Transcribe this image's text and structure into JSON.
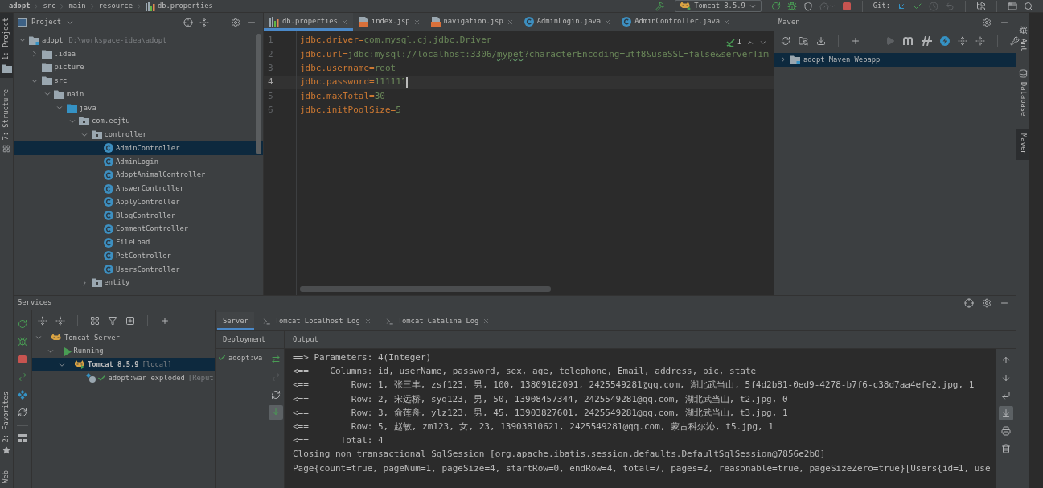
{
  "breadcrumb": [
    "adopt",
    "src",
    "main",
    "resource",
    "db.properties"
  ],
  "toolbar": [
    {
      "kind": "build",
      "disabled": false
    },
    {
      "kind": "run-config",
      "label": "Tomcat 8.5.9"
    },
    {
      "kind": "rerun",
      "disabled": false
    },
    {
      "kind": "debug",
      "disabled": false
    },
    {
      "kind": "coverage",
      "disabled": false
    },
    {
      "kind": "profile",
      "disabled": true
    },
    {
      "kind": "stop",
      "disabled": false
    },
    {
      "kind": "separator"
    },
    {
      "kind": "label",
      "label": "Git:"
    },
    {
      "kind": "update",
      "disabled": false
    },
    {
      "kind": "commit",
      "disabled": false
    },
    {
      "kind": "history",
      "disabled": true
    },
    {
      "kind": "rollback",
      "disabled": true
    },
    {
      "kind": "separator"
    },
    {
      "kind": "project-structure",
      "disabled": false
    },
    {
      "kind": "separator"
    },
    {
      "kind": "tool-window",
      "disabled": false
    },
    {
      "kind": "search",
      "disabled": false
    }
  ],
  "left_stripe": {
    "top": [
      {
        "label": "1: Project",
        "kind": "project",
        "selected": true
      },
      {
        "label": "7: Structure",
        "kind": "structure",
        "selected": false
      }
    ],
    "bottom": [
      {
        "label": "2: Favorites",
        "kind": "favorites",
        "selected": false
      },
      {
        "label": "Web",
        "kind": "web",
        "selected": false
      }
    ]
  },
  "project": {
    "title": "Project",
    "tree": [
      {
        "label": "adopt",
        "path": "D:\\workspace-idea\\adopt",
        "kind": "module",
        "expanded": true,
        "selected": false,
        "children": [
          {
            "label": ".idea",
            "kind": "folder",
            "expanded": false,
            "selected": false
          },
          {
            "label": "picture",
            "kind": "folder",
            "selected": false
          },
          {
            "label": "src",
            "kind": "folder",
            "expanded": true,
            "selected": false,
            "children": [
              {
                "label": "main",
                "kind": "folder",
                "expanded": true,
                "selected": false,
                "children": [
                  {
                    "label": "java",
                    "kind": "source-folder",
                    "expanded": true,
                    "selected": false,
                    "children": [
                      {
                        "label": "com.ecjtu",
                        "kind": "package",
                        "expanded": true,
                        "selected": false,
                        "children": [
                          {
                            "label": "controller",
                            "kind": "package",
                            "expanded": true,
                            "selected": false,
                            "children": [
                              {
                                "label": "AdminController",
                                "kind": "class",
                                "selected": true
                              },
                              {
                                "label": "AdminLogin",
                                "kind": "class",
                                "selected": false
                              },
                              {
                                "label": "AdoptAnimalController",
                                "kind": "class",
                                "selected": false
                              },
                              {
                                "label": "AnswerController",
                                "kind": "class",
                                "selected": false
                              },
                              {
                                "label": "ApplyController",
                                "kind": "class",
                                "selected": false
                              },
                              {
                                "label": "BlogController",
                                "kind": "class",
                                "selected": false
                              },
                              {
                                "label": "CommentController",
                                "kind": "class",
                                "selected": false
                              },
                              {
                                "label": "FileLoad",
                                "kind": "class",
                                "selected": false
                              },
                              {
                                "label": "PetController",
                                "kind": "class",
                                "selected": false
                              },
                              {
                                "label": "UsersController",
                                "kind": "class",
                                "selected": false
                              }
                            ]
                          },
                          {
                            "label": "entity",
                            "kind": "package",
                            "expanded": false,
                            "selected": false
                          }
                        ]
                      }
                    ]
                  }
                ]
              }
            ]
          }
        ]
      }
    ]
  },
  "editor": {
    "tabs": [
      {
        "label": "db.properties",
        "kind": "properties",
        "selected": true
      },
      {
        "label": "index.jsp",
        "kind": "jsp",
        "selected": false
      },
      {
        "label": "navigation.jsp",
        "kind": "jsp",
        "selected": false
      },
      {
        "label": "AdminLogin.java",
        "kind": "class",
        "selected": false
      },
      {
        "label": "AdminController.java",
        "kind": "class",
        "selected": false
      }
    ],
    "inspection": {
      "count": "1"
    },
    "lines": [
      {
        "number": "1",
        "key": "jdbc.driver",
        "separator": "=",
        "value": [
          {
            "text": "com.mysql.cj.jdbc.Driver",
            "typo": false
          }
        ],
        "current": false
      },
      {
        "number": "2",
        "key": "jdbc.url",
        "separator": "=",
        "value": [
          {
            "text": "jdbc:mysql://localhost:3306/",
            "typo": false
          },
          {
            "text": "mypet",
            "typo": true
          },
          {
            "text": "?characterEncoding=utf8&useSSL=false&serverTim",
            "typo": false
          }
        ],
        "current": false
      },
      {
        "number": "3",
        "key": "jdbc.username",
        "separator": "=",
        "value": [
          {
            "text": "root",
            "typo": false
          }
        ],
        "current": false
      },
      {
        "number": "4",
        "key": "jdbc.password",
        "separator": "=",
        "value": [
          {
            "text": "111111",
            "typo": false
          }
        ],
        "current": true
      },
      {
        "number": "5",
        "key": "jdbc.maxTotal",
        "separator": "=",
        "value": [
          {
            "text": "30",
            "typo": false
          }
        ],
        "current": false
      },
      {
        "number": "6",
        "key": "jdbc.initPoolSize",
        "separator": "=",
        "value": [
          {
            "text": "5",
            "typo": false
          }
        ],
        "current": false
      }
    ]
  },
  "maven": {
    "title": "Maven",
    "toolbar": [
      {
        "kind": "reload",
        "disabled": false
      },
      {
        "kind": "generate-sources",
        "disabled": false
      },
      {
        "kind": "download",
        "disabled": false
      },
      {
        "kind": "separator"
      },
      {
        "kind": "add",
        "disabled": false
      },
      {
        "kind": "separator"
      },
      {
        "kind": "run",
        "disabled": true
      },
      {
        "kind": "execute-goal",
        "disabled": false
      },
      {
        "kind": "offline",
        "disabled": false
      },
      {
        "kind": "skip-tests",
        "disabled": false
      },
      {
        "kind": "expand",
        "disabled": false
      },
      {
        "kind": "collapse",
        "disabled": false
      },
      {
        "kind": "separator"
      },
      {
        "kind": "settings",
        "disabled": false
      }
    ],
    "tree": [
      {
        "label": "adopt Maven Webapp",
        "expanded": false,
        "selected": true
      }
    ]
  },
  "right_stripe": [
    {
      "label": "Ant",
      "kind": "ant",
      "selected": false
    },
    {
      "label": "Database",
      "kind": "database",
      "selected": false
    },
    {
      "label": "Maven",
      "kind": "maven",
      "selected": true
    }
  ],
  "services": {
    "title": "Services",
    "tree": [
      {
        "label": "Tomcat Server",
        "kind": "server-group",
        "expanded": true,
        "selected": false,
        "children": [
          {
            "label": "Running",
            "kind": "status",
            "expanded": true,
            "selected": false,
            "children": [
              {
                "label": "Tomcat 8.5.9",
                "suffix": "[local]",
                "kind": "run-config",
                "expanded": true,
                "selected": true,
                "children": [
                  {
                    "label": "adopt:war exploded",
                    "suffix": "[Reput",
                    "kind": "artifact",
                    "selected": false
                  }
                ]
              }
            ]
          }
        ]
      }
    ],
    "tabs": [
      {
        "label": "Server",
        "kind": "server",
        "selected": true
      },
      {
        "label": "Tomcat Localhost Log",
        "kind": "log",
        "selected": false
      },
      {
        "label": "Tomcat Catalina Log",
        "kind": "log",
        "selected": false
      }
    ],
    "deployment": {
      "title": "Deployment",
      "items": [
        {
          "label": "adopt:wa",
          "deployed": true
        }
      ],
      "toolbar": [
        {
          "kind": "deploy",
          "disabled": false,
          "on": false
        },
        {
          "kind": "undeploy",
          "disabled": true,
          "on": false
        },
        {
          "kind": "refresh",
          "disabled": false,
          "on": false
        },
        {
          "kind": "select-in-output",
          "disabled": false,
          "on": true
        }
      ]
    },
    "output": {
      "title": "Output",
      "lines": [
        "==> Parameters: 4(Integer)",
        "<==    Columns: id, userName, password, sex, age, telephone, Email, address, pic, state",
        "<==        Row: 1, 张三丰, zsf123, 男, 100, 13809182091, 2425549281@qq.com, 湖北武当山, 5f4d2b81-0ed9-4278-b7f6-c38d7aa4efe2.jpg, 1",
        "<==        Row: 2, 宋远桥, syq123, 男, 50, 13908457344, 2425549281@qq.com, 湖北武当山, t2.jpg, 0",
        "<==        Row: 3, 俞莲舟, ylz123, 男, 45, 13903827601, 2425549281@qq.com, 湖北武当山, t3.jpg, 1",
        "<==        Row: 5, 赵敏, zm123, 女, 23, 13903810621, 2425549281@qq.com, 蒙古科尔沁, t5.jpg, 1",
        "<==      Total: 4",
        "Closing non transactional SqlSession [org.apache.ibatis.session.defaults.DefaultSqlSession@7856e2b0]",
        "Page{count=true, pageNum=1, pageSize=4, startRow=0, endRow=4, total=7, pages=2, reasonable=true, pageSizeZero=true}[Users{id=1, use"
      ],
      "toolbar": [
        {
          "kind": "up",
          "on": false
        },
        {
          "kind": "down",
          "on": false
        },
        {
          "kind": "soft-wrap",
          "on": false
        },
        {
          "kind": "scroll-to-end",
          "on": true
        },
        {
          "kind": "print",
          "on": false
        },
        {
          "kind": "clear",
          "on": false
        }
      ]
    }
  }
}
